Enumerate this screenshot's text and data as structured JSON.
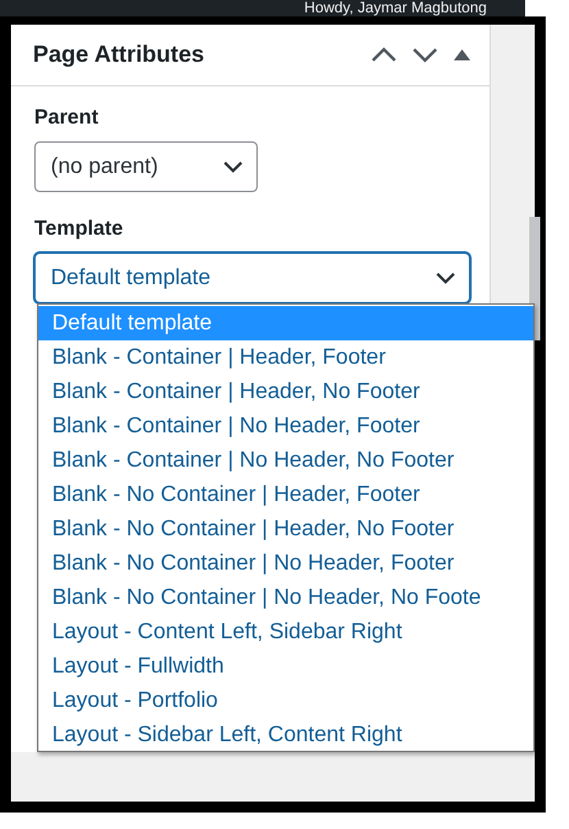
{
  "top_bar": {
    "greeting": "Howdy, Jaymar Magbutong"
  },
  "panel": {
    "title": "Page Attributes"
  },
  "fields": [
    {
      "label": "Parent",
      "value": "(no parent)",
      "focused": false
    },
    {
      "label": "Template",
      "value": "Default template",
      "focused": true
    }
  ],
  "dropdown": {
    "options": [
      {
        "label": "Default template",
        "selected": true
      },
      {
        "label": "Blank - Container | Header, Footer",
        "selected": false
      },
      {
        "label": "Blank - Container | Header, No Footer",
        "selected": false
      },
      {
        "label": "Blank - Container | No Header, Footer",
        "selected": false
      },
      {
        "label": "Blank - Container | No Header, No Footer",
        "selected": false
      },
      {
        "label": "Blank - No Container | Header, Footer",
        "selected": false
      },
      {
        "label": "Blank - No Container | Header, No Footer",
        "selected": false
      },
      {
        "label": "Blank - No Container | No Header, Footer",
        "selected": false
      },
      {
        "label": "Blank - No Container | No Header, No Foote",
        "selected": false
      },
      {
        "label": "Layout - Content Left, Sidebar Right",
        "selected": false
      },
      {
        "label": "Layout - Fullwidth",
        "selected": false
      },
      {
        "label": "Layout - Portfolio",
        "selected": false
      },
      {
        "label": "Layout - Sidebar Left, Content Right",
        "selected": false
      }
    ]
  }
}
